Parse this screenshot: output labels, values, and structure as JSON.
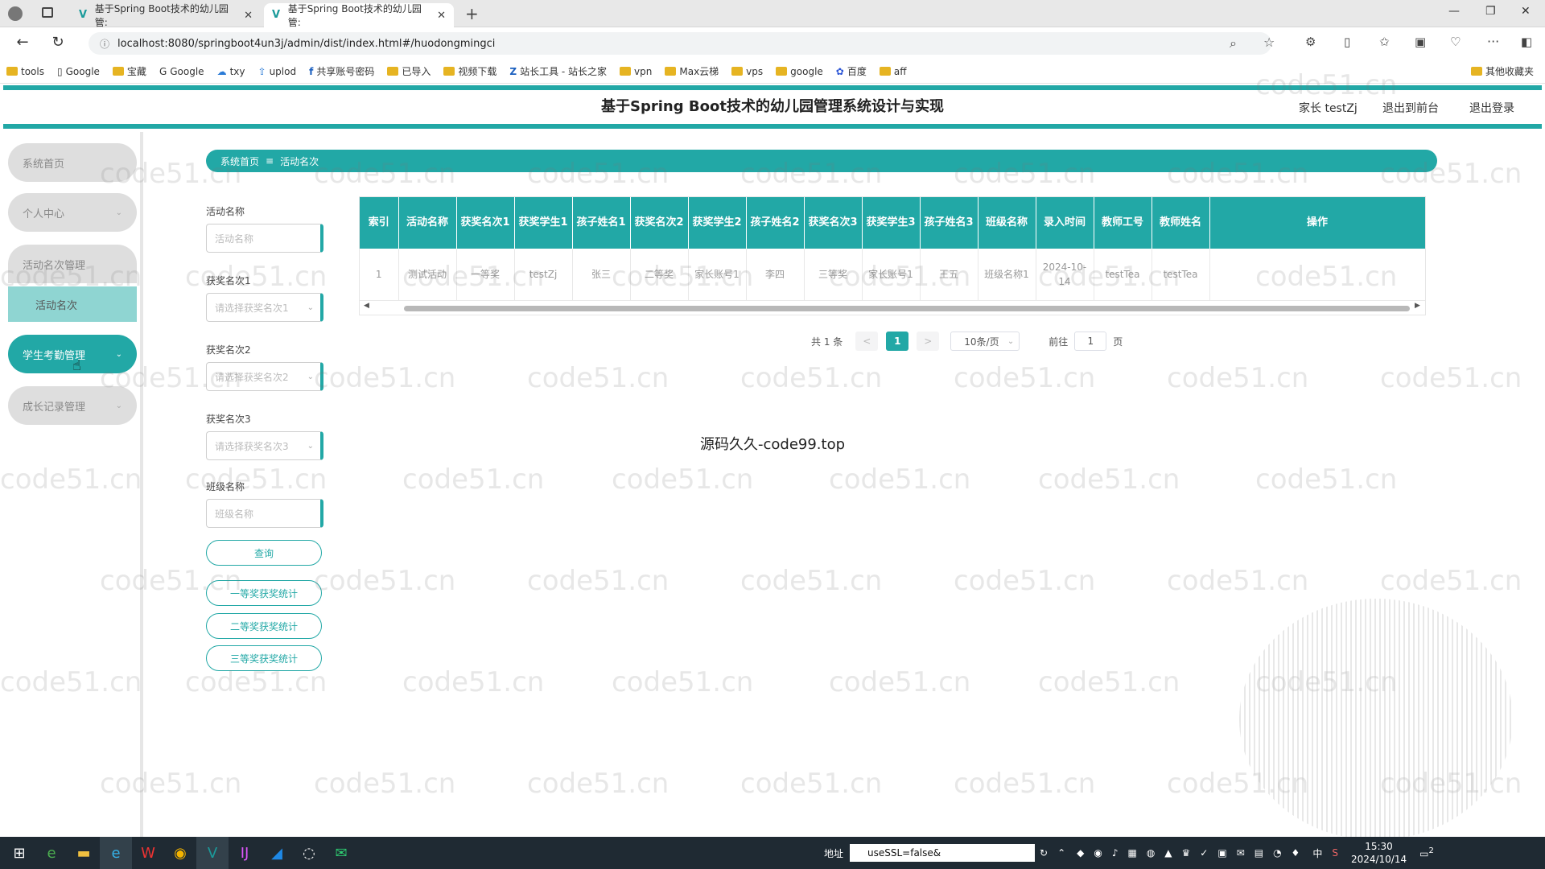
{
  "browser": {
    "tabs": [
      {
        "title": "基于Spring Boot技术的幼儿园管:"
      },
      {
        "title": "基于Spring Boot技术的幼儿园管:"
      }
    ],
    "url": "localhost:8080/springboot4un3j/admin/dist/index.html#/huodongmingci",
    "bookmarks": [
      "tools",
      "Google",
      "宝藏",
      "Google",
      "txy",
      "uplod",
      "共享账号密码",
      "已导入",
      "视频下载",
      "站长工具 - 站长之家",
      "vpn",
      "Max云梯",
      "vps",
      "google",
      "百度",
      "aff"
    ],
    "other_bookmarks": "其他收藏夹"
  },
  "header": {
    "title": "基于Spring Boot技术的幼儿园管理系统设计与实现",
    "user": "家长 testZj",
    "front": "退出到前台",
    "logout": "退出登录"
  },
  "sidebar": {
    "items": [
      {
        "label": "系统首页"
      },
      {
        "label": "个人中心"
      },
      {
        "label": "活动名次管理"
      },
      {
        "label": "学生考勤管理"
      },
      {
        "label": "成长记录管理"
      }
    ],
    "sub_item": "活动名次"
  },
  "breadcrumb": {
    "home": "系统首页",
    "sep": "≡",
    "current": "活动名次"
  },
  "filters": {
    "activity_label": "活动名称",
    "activity_placeholder": "活动名称",
    "award1_label": "获奖名次1",
    "award1_placeholder": "请选择获奖名次1",
    "award2_label": "获奖名次2",
    "award2_placeholder": "请选择获奖名次2",
    "award3_label": "获奖名次3",
    "award3_placeholder": "请选择获奖名次3",
    "class_label": "班级名称",
    "class_placeholder": "班级名称"
  },
  "buttons": {
    "query": "查询",
    "stat1": "一等奖获奖统计",
    "stat2": "二等奖获奖统计",
    "stat3": "三等奖获奖统计"
  },
  "table": {
    "headers": [
      "索引",
      "活动名称",
      "获奖名次1",
      "获奖学生1",
      "孩子姓名1",
      "获奖名次2",
      "获奖学生2",
      "孩子姓名2",
      "获奖名次3",
      "获奖学生3",
      "孩子姓名3",
      "班级名称",
      "录入时间",
      "教师工号",
      "教师姓名",
      "操作"
    ],
    "rows": [
      [
        "1",
        "测试活动",
        "一等奖",
        "testZj",
        "张三",
        "二等奖",
        "家长账号1",
        "李四",
        "三等奖",
        "家长账号1",
        "王五",
        "班级名称1",
        "2024-10-14",
        "testTea",
        "testTea",
        ""
      ]
    ]
  },
  "pagination": {
    "total": "共 1 条",
    "prev": "<",
    "page": "1",
    "next": ">",
    "size": "10条/页",
    "goto": "前往",
    "jump": "1",
    "unit": "页"
  },
  "center_text": "源码久久-code99.top",
  "watermark": "code51.cn",
  "taskbar": {
    "addr_label": "地址",
    "addr_value": "useSSL=false&",
    "time": "15:30",
    "date": "2024/10/14",
    "ime": "中",
    "notif": "2"
  },
  "colors": {
    "accent": "#22a8a6",
    "sub_menu": "#8fd5d2"
  }
}
